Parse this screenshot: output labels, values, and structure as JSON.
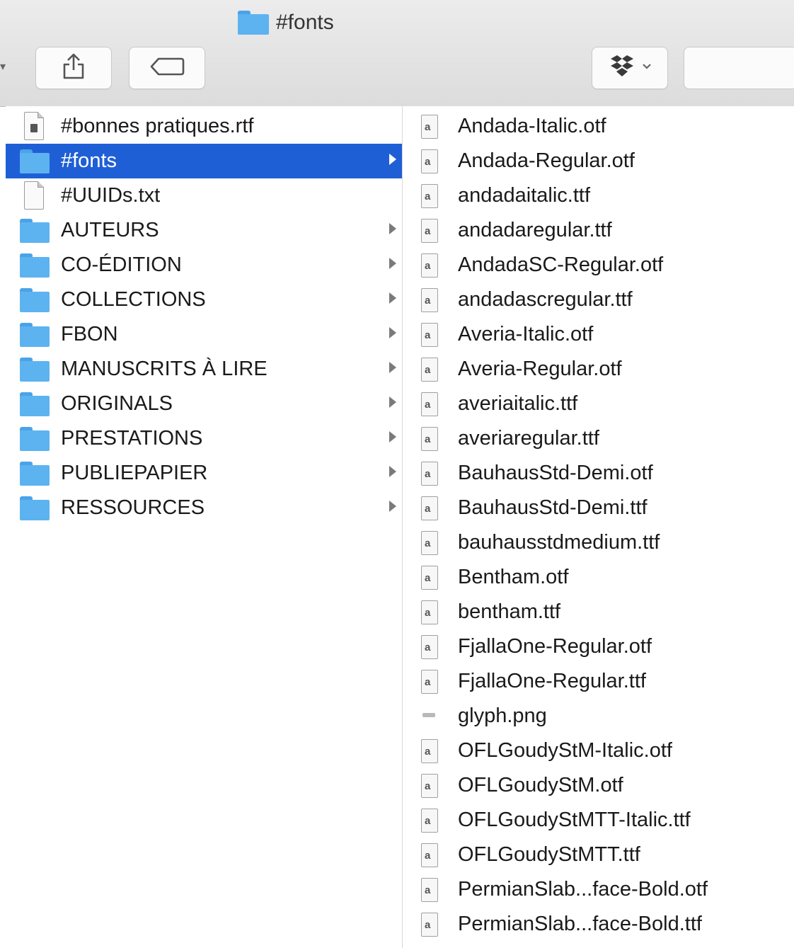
{
  "window": {
    "title": "#fonts"
  },
  "toolbar": {
    "share_icon": "share-icon",
    "tag_icon": "tag-icon",
    "dropbox_icon": "dropbox-icon"
  },
  "left_column": {
    "items": [
      {
        "label": "#bonnes pratiques.rtf",
        "kind": "doc",
        "has_children": false,
        "selected": false
      },
      {
        "label": "#fonts",
        "kind": "folder",
        "has_children": true,
        "selected": true
      },
      {
        "label": "#UUIDs.txt",
        "kind": "doc-plain",
        "has_children": false,
        "selected": false
      },
      {
        "label": "AUTEURS",
        "kind": "folder",
        "has_children": true,
        "selected": false
      },
      {
        "label": "CO-ÉDITION",
        "kind": "folder",
        "has_children": true,
        "selected": false
      },
      {
        "label": "COLLECTIONS",
        "kind": "folder",
        "has_children": true,
        "selected": false
      },
      {
        "label": "FBON",
        "kind": "folder",
        "has_children": true,
        "selected": false
      },
      {
        "label": "MANUSCRITS À LIRE",
        "kind": "folder",
        "has_children": true,
        "selected": false
      },
      {
        "label": "ORIGINALS",
        "kind": "folder",
        "has_children": true,
        "selected": false
      },
      {
        "label": "PRESTATIONS",
        "kind": "folder",
        "has_children": true,
        "selected": false
      },
      {
        "label": "PUBLIEPAPIER",
        "kind": "folder",
        "has_children": true,
        "selected": false
      },
      {
        "label": "RESSOURCES",
        "kind": "folder",
        "has_children": true,
        "selected": false
      }
    ]
  },
  "right_column": {
    "items": [
      {
        "label": "Andada-Italic.otf",
        "kind": "font"
      },
      {
        "label": "Andada-Regular.otf",
        "kind": "font"
      },
      {
        "label": "andadaitalic.ttf",
        "kind": "font"
      },
      {
        "label": "andadaregular.ttf",
        "kind": "font"
      },
      {
        "label": "AndadaSC-Regular.otf",
        "kind": "font"
      },
      {
        "label": "andadascregular.ttf",
        "kind": "font"
      },
      {
        "label": "Averia-Italic.otf",
        "kind": "font"
      },
      {
        "label": "Averia-Regular.otf",
        "kind": "font"
      },
      {
        "label": "averiaitalic.ttf",
        "kind": "font"
      },
      {
        "label": "averiaregular.ttf",
        "kind": "font"
      },
      {
        "label": "BauhausStd-Demi.otf",
        "kind": "font"
      },
      {
        "label": "BauhausStd-Demi.ttf",
        "kind": "font"
      },
      {
        "label": "bauhausstdmedium.ttf",
        "kind": "font"
      },
      {
        "label": "Bentham.otf",
        "kind": "font"
      },
      {
        "label": "bentham.ttf",
        "kind": "font"
      },
      {
        "label": "FjallaOne-Regular.otf",
        "kind": "font"
      },
      {
        "label": "FjallaOne-Regular.ttf",
        "kind": "font"
      },
      {
        "label": "glyph.png",
        "kind": "png"
      },
      {
        "label": "OFLGoudyStM-Italic.otf",
        "kind": "font"
      },
      {
        "label": "OFLGoudyStM.otf",
        "kind": "font"
      },
      {
        "label": "OFLGoudyStMTT-Italic.ttf",
        "kind": "font"
      },
      {
        "label": "OFLGoudyStMTT.ttf",
        "kind": "font"
      },
      {
        "label": "PermianSlab...face-Bold.otf",
        "kind": "font"
      },
      {
        "label": "PermianSlab...face-Bold.ttf",
        "kind": "font"
      }
    ]
  },
  "colors": {
    "selection": "#1f5fd6",
    "folder": "#5db3f0"
  }
}
